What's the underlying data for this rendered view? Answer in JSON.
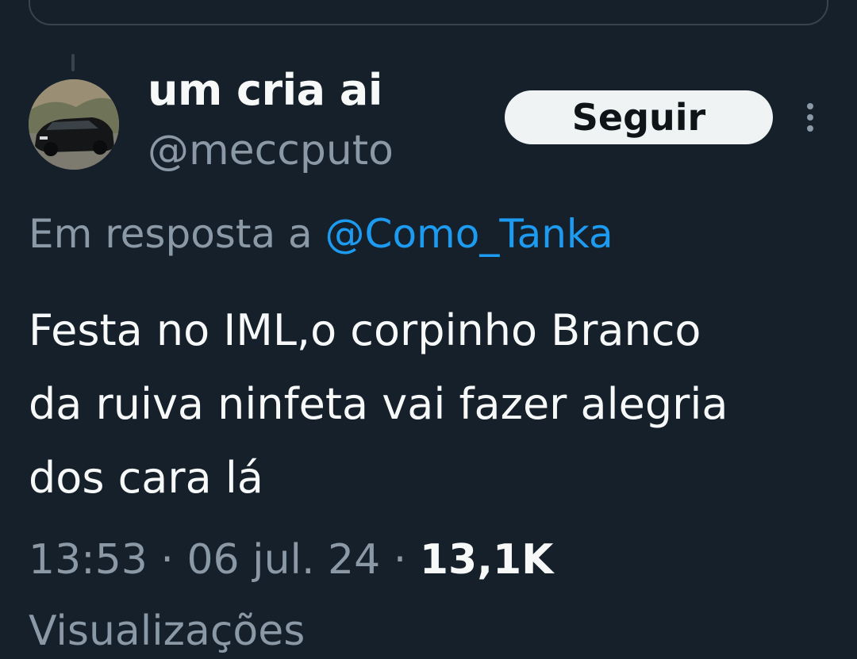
{
  "tweet": {
    "author": {
      "display_name": "um cria ai",
      "handle": "@meccputo",
      "avatar_icon": "car-photo-avatar"
    },
    "follow_label": "Seguir",
    "more_icon": "more-vertical-icon",
    "reply_prefix": "Em resposta a",
    "reply_to": "@Como_Tanka",
    "text_lines": [
      "Festa no IML,o corpinho Branco",
      "da ruiva ninfeta vai fazer alegria",
      "dos cara lá"
    ],
    "time": "13:53",
    "separator": "·",
    "date": "06 jul. 24",
    "views_count": "13,1K",
    "views_label": "Visualizações"
  },
  "colors": {
    "background": "#15202b",
    "primary_text": "#f7f9f9",
    "secondary_text": "#8b98a5",
    "link": "#1d9bf0",
    "button_bg": "#eff3f4",
    "border": "#38444d"
  }
}
